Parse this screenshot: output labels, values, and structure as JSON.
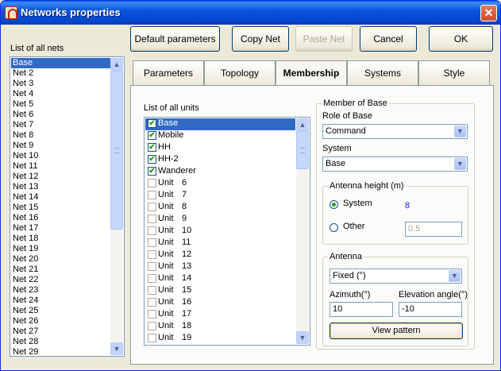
{
  "window": {
    "title": "Networks properties",
    "close_glyph": "✕"
  },
  "left_list": {
    "label": "List of all nets",
    "items": [
      "Base",
      "Net  2",
      "Net  3",
      "Net  4",
      "Net  5",
      "Net  6",
      "Net  7",
      "Net  8",
      "Net  9",
      "Net 10",
      "Net 11",
      "Net 12",
      "Net 13",
      "Net 14",
      "Net 15",
      "Net 16",
      "Net 17",
      "Net 18",
      "Net 19",
      "Net 20",
      "Net 21",
      "Net 22",
      "Net 23",
      "Net 24",
      "Net 25",
      "Net 26",
      "Net 27",
      "Net 28",
      "Net 29"
    ],
    "selected_index": 0
  },
  "toolbar": {
    "default_params": "Default parameters",
    "copy_net": "Copy Net",
    "paste_net": "Paste Net",
    "cancel": "Cancel",
    "ok": "OK"
  },
  "tabs": [
    {
      "label": "Parameters",
      "active": false
    },
    {
      "label": "Topology",
      "active": false
    },
    {
      "label": "Membership",
      "active": true
    },
    {
      "label": "Systems",
      "active": false
    },
    {
      "label": "Style",
      "active": false
    }
  ],
  "units": {
    "label": "List of all units",
    "items": [
      {
        "name": "Base",
        "num": "",
        "checked": true
      },
      {
        "name": "Mobile",
        "num": "",
        "checked": true
      },
      {
        "name": "HH",
        "num": "",
        "checked": true
      },
      {
        "name": "HH-2",
        "num": "",
        "checked": true
      },
      {
        "name": "Wanderer",
        "num": "",
        "checked": true
      },
      {
        "name": "Unit",
        "num": "6",
        "checked": false
      },
      {
        "name": "Unit",
        "num": "7",
        "checked": false
      },
      {
        "name": "Unit",
        "num": "8",
        "checked": false
      },
      {
        "name": "Unit",
        "num": "9",
        "checked": false
      },
      {
        "name": "Unit",
        "num": "10",
        "checked": false
      },
      {
        "name": "Unit",
        "num": "11",
        "checked": false
      },
      {
        "name": "Unit",
        "num": "12",
        "checked": false
      },
      {
        "name": "Unit",
        "num": "13",
        "checked": false
      },
      {
        "name": "Unit",
        "num": "14",
        "checked": false
      },
      {
        "name": "Unit",
        "num": "15",
        "checked": false
      },
      {
        "name": "Unit",
        "num": "16",
        "checked": false
      },
      {
        "name": "Unit",
        "num": "17",
        "checked": false
      },
      {
        "name": "Unit",
        "num": "18",
        "checked": false
      },
      {
        "name": "Unit",
        "num": "19",
        "checked": false
      }
    ],
    "selected_index": 0
  },
  "member": {
    "group_title": "Member of Base",
    "role_label": "Role of Base",
    "role_value": "Command",
    "system_label": "System",
    "system_value": "Base",
    "antenna_height": {
      "title": "Antenna height (m)",
      "system_label": "System",
      "system_value": "8",
      "other_label": "Other",
      "other_value": "0.5",
      "selected": "System"
    },
    "antenna": {
      "title": "Antenna",
      "type_value": "Fixed (°)",
      "azimuth_label": "Azimuth(°)",
      "azimuth_value": "10",
      "elevation_label": "Elevation angle(°)",
      "elevation_value": "-10",
      "view_pattern": "View pattern"
    }
  },
  "colors": {
    "selection": "#316ac5",
    "value_blue": "#1a1ad0"
  }
}
